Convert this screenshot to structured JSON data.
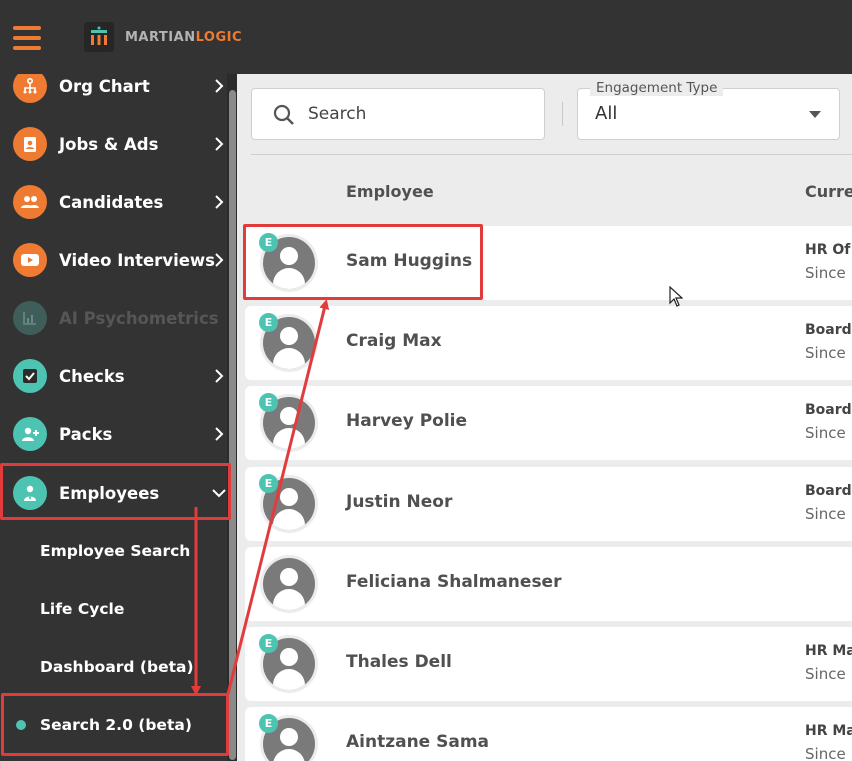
{
  "brand": {
    "logo_part1": "MARTIAN",
    "logo_part2": "LOGIC",
    "accent": "#ef7b33"
  },
  "sidebar": {
    "items": [
      {
        "label": "Org Chart",
        "icon": "org-chart-icon",
        "color": "#ef7b33"
      },
      {
        "label": "Jobs & Ads",
        "icon": "clipboard-icon",
        "color": "#ef7b33"
      },
      {
        "label": "Candidates",
        "icon": "people-icon",
        "color": "#ef7b33"
      },
      {
        "label": "Video Interviews",
        "icon": "video-icon",
        "color": "#ef7b33"
      },
      {
        "label": "AI Psychometrics",
        "icon": "chart-icon",
        "color": "#3f5e5a"
      },
      {
        "label": "Checks",
        "icon": "checkbox-icon",
        "color": "#4dc4b2"
      },
      {
        "label": "Packs",
        "icon": "add-person-icon",
        "color": "#4dc4b2"
      },
      {
        "label": "Employees",
        "icon": "employee-icon",
        "color": "#4dc4b2"
      }
    ],
    "sub_items": [
      {
        "label": "Employee Search"
      },
      {
        "label": "Life Cycle"
      },
      {
        "label": "Dashboard (beta)"
      },
      {
        "label": "Search 2.0 (beta)"
      }
    ]
  },
  "main": {
    "search_placeholder": "Search",
    "engagement_label": "Engagement Type",
    "engagement_value": "All",
    "columns": {
      "employee": "Employee",
      "current": "Curre"
    },
    "badge": "E",
    "rows": [
      {
        "name": "Sam Huggins",
        "position": "HR Of",
        "since": "Since"
      },
      {
        "name": "Craig Max",
        "position": "Board",
        "since": "Since"
      },
      {
        "name": "Harvey Polie",
        "position": "Board",
        "since": "Since"
      },
      {
        "name": "Justin Neor",
        "position": "Board",
        "since": "Since"
      },
      {
        "name": "Feliciana Shalmaneser",
        "position": "",
        "since": ""
      },
      {
        "name": "Thales Dell",
        "position": "HR Ma",
        "since": "Since"
      },
      {
        "name": "Aintzane Sama",
        "position": "HR Ma",
        "since": "Since"
      }
    ]
  }
}
